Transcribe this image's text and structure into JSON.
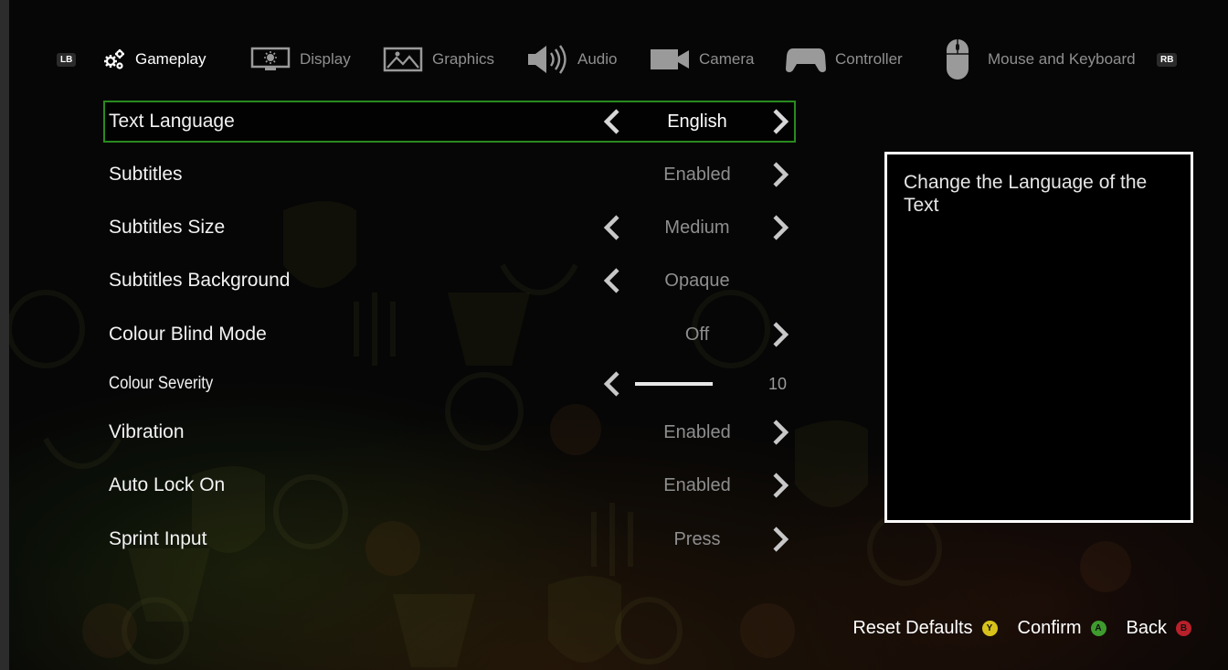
{
  "tabs": {
    "left_bumper": "LB",
    "right_bumper": "RB",
    "items": [
      {
        "label": "Gameplay",
        "icon": "gears-icon",
        "active": true
      },
      {
        "label": "Display",
        "icon": "monitor-icon",
        "active": false
      },
      {
        "label": "Graphics",
        "icon": "image-icon",
        "active": false
      },
      {
        "label": "Audio",
        "icon": "speaker-icon",
        "active": false
      },
      {
        "label": "Camera",
        "icon": "video-camera-icon",
        "active": false
      },
      {
        "label": "Controller",
        "icon": "gamepad-icon",
        "active": false
      },
      {
        "label": "Mouse and Keyboard",
        "icon": "mouse-icon",
        "active": false
      }
    ]
  },
  "settings": [
    {
      "label": "Text Language",
      "value": "English",
      "left_arrow": true,
      "right_arrow": true,
      "selected": true
    },
    {
      "label": "Subtitles",
      "value": "Enabled",
      "left_arrow": false,
      "right_arrow": true
    },
    {
      "label": "Subtitles Size",
      "value": "Medium",
      "left_arrow": true,
      "right_arrow": true
    },
    {
      "label": "Subtitles Background",
      "value": "Opaque",
      "left_arrow": true,
      "right_arrow": false
    },
    {
      "label": "Colour Blind Mode",
      "value": "Off",
      "left_arrow": false,
      "right_arrow": true
    },
    {
      "label": "Colour Severity",
      "value": "10",
      "slider_fraction": 1.0,
      "left_arrow": true,
      "right_arrow": false
    },
    {
      "label": "Vibration",
      "value": "Enabled",
      "left_arrow": false,
      "right_arrow": true
    },
    {
      "label": "Auto Lock On",
      "value": "Enabled",
      "left_arrow": false,
      "right_arrow": true
    },
    {
      "label": "Sprint Input",
      "value": "Press",
      "left_arrow": false,
      "right_arrow": true
    }
  ],
  "description": {
    "text": "Change the Language of the Text"
  },
  "footer": {
    "reset_label": "Reset Defaults",
    "reset_button": "Y",
    "confirm_label": "Confirm",
    "confirm_button": "A",
    "back_label": "Back",
    "back_button": "B"
  },
  "colors": {
    "selection_border": "#2a8a1f",
    "button_y": "#d8c21a",
    "button_a": "#3e9b2e",
    "button_b": "#b8202a"
  }
}
